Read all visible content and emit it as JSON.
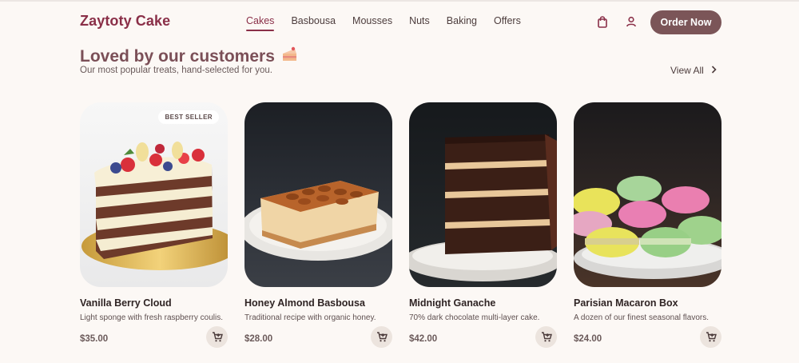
{
  "header": {
    "brand": "Zaytoty Cake",
    "nav": [
      "Cakes",
      "Basbousa",
      "Mousses",
      "Nuts",
      "Baking",
      "Offers"
    ],
    "active_nav": "Cakes",
    "bag_icon": "shopping-bag-icon",
    "user_icon": "user-icon",
    "cta_label": "Order Now"
  },
  "section": {
    "title": "Loved by our customers",
    "title_icon": "cake-slice-icon",
    "subtitle": "Our most popular treats, hand-selected for you.",
    "view_all": "View All"
  },
  "products": [
    {
      "name": "Vanilla Berry Cloud",
      "description": "Light sponge with fresh raspberry coulis.",
      "price": "$35.00",
      "badge": "BEST SELLER"
    },
    {
      "name": "Honey Almond Basbousa",
      "description": "Traditional recipe with organic honey.",
      "price": "$28.00"
    },
    {
      "name": "Midnight Ganache",
      "description": "70% dark chocolate multi-layer cake.",
      "price": "$42.00"
    },
    {
      "name": "Parisian Macaron Box",
      "description": "A dozen of our finest seasonal flavors.",
      "price": "$24.00"
    }
  ],
  "colors": {
    "brand": "#8a2f48",
    "accent_button": "#7b5558",
    "background": "#fcf8f5",
    "cart_button": "#ece4de"
  }
}
